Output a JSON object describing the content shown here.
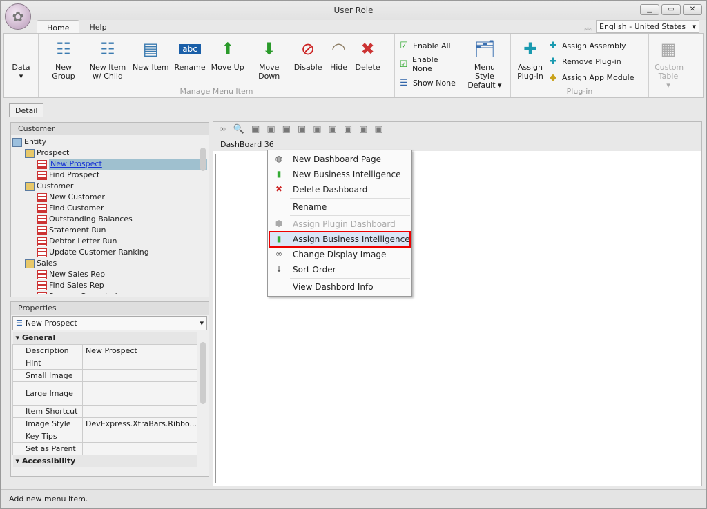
{
  "window": {
    "title": "User Role"
  },
  "ribbon": {
    "tabs": [
      "Home",
      "Help"
    ],
    "language": "English - United States",
    "data_label": "Data",
    "manage_buttons": [
      {
        "label": "New Group",
        "icon": "new-group-icon"
      },
      {
        "label": "New Item w/ Child",
        "icon": "new-item-child-icon"
      },
      {
        "label": "New Item",
        "icon": "new-item-icon"
      },
      {
        "label": "Rename",
        "icon": "rename-icon"
      },
      {
        "label": "Move Up",
        "icon": "arrow-up-icon"
      },
      {
        "label": "Move Down",
        "icon": "arrow-down-icon"
      },
      {
        "label": "Disable",
        "icon": "disable-icon"
      },
      {
        "label": "Hide",
        "icon": "hide-icon"
      },
      {
        "label": "Delete",
        "icon": "delete-icon"
      }
    ],
    "enable_all": "Enable All",
    "enable_none": "Enable None",
    "show_none": "Show None",
    "menu_style": "Menu Style",
    "menu_style_value": "Default",
    "manage_group_label": "Manage Menu Item",
    "assign_plugin": "Assign Plug-in",
    "assign_assembly": "Assign Assembly",
    "remove_plugin": "Remove Plug-in",
    "assign_app_module": "Assign App Module",
    "custom_table": "Custom Table",
    "plugin_group_label": "Plug-in"
  },
  "detail_tab": "Detail",
  "tree": {
    "header": "Customer",
    "items": [
      {
        "label": "Entity",
        "level": 0,
        "type": "root"
      },
      {
        "label": "Prospect",
        "level": 1,
        "type": "group"
      },
      {
        "label": "New Prospect",
        "level": 2,
        "type": "item",
        "selected": true
      },
      {
        "label": "Find Prospect",
        "level": 2,
        "type": "item"
      },
      {
        "label": "Customer",
        "level": 1,
        "type": "group"
      },
      {
        "label": "New Customer",
        "level": 2,
        "type": "item"
      },
      {
        "label": "Find Customer",
        "level": 2,
        "type": "item"
      },
      {
        "label": "Outstanding Balances",
        "level": 2,
        "type": "item"
      },
      {
        "label": "Statement Run",
        "level": 2,
        "type": "item"
      },
      {
        "label": "Debtor Letter Run",
        "level": 2,
        "type": "item"
      },
      {
        "label": "Update Customer Ranking",
        "level": 2,
        "type": "item"
      },
      {
        "label": "Sales",
        "level": 1,
        "type": "group"
      },
      {
        "label": "New Sales Rep",
        "level": 2,
        "type": "item"
      },
      {
        "label": "Find Sales Rep",
        "level": 2,
        "type": "item"
      },
      {
        "label": "Process Commission",
        "level": 2,
        "type": "item"
      }
    ]
  },
  "properties": {
    "header": "Properties",
    "selected": "New Prospect",
    "cat_general": "General",
    "cat_accessibility": "Accessibility",
    "rows": [
      {
        "key": "Description",
        "value": "New Prospect"
      },
      {
        "key": "Hint",
        "value": ""
      },
      {
        "key": "Small Image",
        "value": ""
      },
      {
        "key": "Large Image",
        "value": ""
      },
      {
        "key": "Item Shortcut",
        "value": ""
      },
      {
        "key": "Image Style",
        "value": "DevExpress.XtraBars.Ribbo..."
      },
      {
        "key": "Key Tips",
        "value": ""
      },
      {
        "key": "Set as Parent",
        "value": ""
      }
    ]
  },
  "dashboard": {
    "tab": "DashBoard 36"
  },
  "context_menu": [
    {
      "label": "New Dashboard Page",
      "icon": "◍"
    },
    {
      "label": "New Business Intelligence",
      "icon": "▮"
    },
    {
      "label": "Delete Dashboard",
      "icon": "✖"
    },
    {
      "sep": true
    },
    {
      "label": "Rename",
      "icon": ""
    },
    {
      "sep": true
    },
    {
      "label": "Assign Plugin Dashboard",
      "icon": "⬢",
      "disabled": true
    },
    {
      "label": "Assign Business Intelligence",
      "icon": "▮",
      "highlight": true
    },
    {
      "label": "Change Display Image",
      "icon": "∞"
    },
    {
      "label": "Sort Order",
      "icon": "↓"
    },
    {
      "sep": true
    },
    {
      "label": "View Dashbord Info",
      "icon": ""
    }
  ],
  "status": "Add new menu item."
}
